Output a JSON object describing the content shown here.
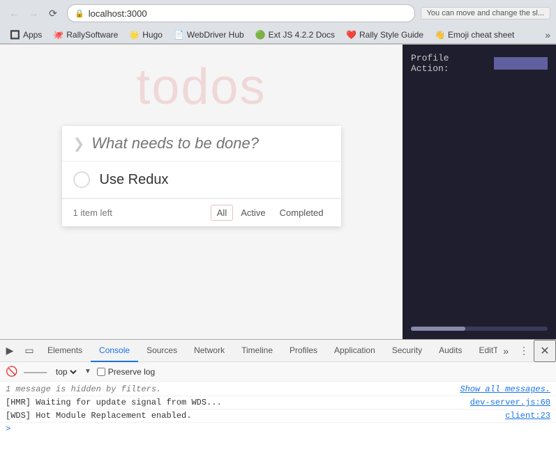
{
  "browser": {
    "address": "localhost:3000",
    "tooltip": "You can move and change the sl...",
    "back_disabled": true,
    "forward_disabled": true
  },
  "bookmarks": {
    "items": [
      {
        "id": "apps",
        "icon": "🔲",
        "label": "Apps"
      },
      {
        "id": "rally-software",
        "icon": "🐙",
        "label": "RallySoftware"
      },
      {
        "id": "hugo",
        "icon": "🌟",
        "label": "Hugo"
      },
      {
        "id": "webdriver-hub",
        "icon": "📄",
        "label": "WebDriver Hub"
      },
      {
        "id": "extjs",
        "icon": "🟢",
        "label": "Ext JS 4.2.2 Docs"
      },
      {
        "id": "rally-style-guide",
        "icon": "❤️",
        "label": "Rally Style Guide"
      },
      {
        "id": "emoji-cheat-sheet",
        "icon": "👋",
        "label": "Emoji cheat sheet"
      }
    ],
    "more_label": "»"
  },
  "todo_app": {
    "title": "todos",
    "input_placeholder": "What needs to be done?",
    "toggle_icon": "❯",
    "items": [
      {
        "text": "Use Redux",
        "completed": false
      }
    ],
    "footer": {
      "item_count": "1 item left",
      "filters": [
        {
          "label": "All",
          "active": true
        },
        {
          "label": "Active",
          "active": false
        },
        {
          "label": "Completed",
          "active": false
        }
      ]
    }
  },
  "profile_panel": {
    "label": "Profile Action:"
  },
  "devtools": {
    "tabs": [
      {
        "label": "Elements",
        "active": false
      },
      {
        "label": "Console",
        "active": true
      },
      {
        "label": "Sources",
        "active": false
      },
      {
        "label": "Network",
        "active": false
      },
      {
        "label": "Timeline",
        "active": false
      },
      {
        "label": "Profiles",
        "active": false
      },
      {
        "label": "Application",
        "active": false
      },
      {
        "label": "Security",
        "active": false
      },
      {
        "label": "Audits",
        "active": false
      },
      {
        "label": "EditThisCookie",
        "active": false
      }
    ],
    "more_tabs_icon": "»",
    "console": {
      "context": "top",
      "preserve_log_label": "Preserve log",
      "messages": [
        {
          "type": "hidden",
          "text": "1 message is hidden by filters.",
          "show_all": "Show all messages."
        },
        {
          "type": "log",
          "text": "[HMR] Waiting for update signal from WDS...",
          "file": "dev-server.js:60"
        },
        {
          "type": "log",
          "text": "[WDS] Hot Module Replacement enabled.",
          "file": "client:23"
        }
      ],
      "prompt": ">"
    }
  }
}
